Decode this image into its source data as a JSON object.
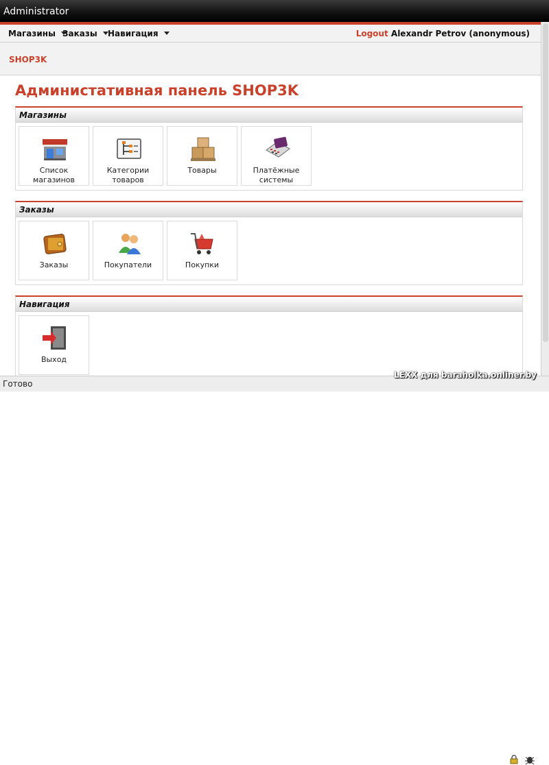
{
  "window": {
    "title": "Administrator"
  },
  "menu": {
    "items": [
      {
        "label": "Магазины"
      },
      {
        "label": "Заказы"
      },
      {
        "label": "Навигация"
      }
    ],
    "logout_label": "Logout",
    "user_label": "Alexandr Petrov (anonymous)"
  },
  "brand": {
    "label": "SHOP3K"
  },
  "page": {
    "title": "Администативная панель SHOP3K"
  },
  "sections": [
    {
      "title": "Магазины",
      "tiles": [
        {
          "label": "Список магазинов",
          "icon": "store-icon"
        },
        {
          "label": "Категории товаров",
          "icon": "category-tree-icon"
        },
        {
          "label": "Товары",
          "icon": "boxes-icon"
        },
        {
          "label": "Платёжные системы",
          "icon": "payment-terminal-icon"
        }
      ]
    },
    {
      "title": "Заказы",
      "tiles": [
        {
          "label": "Заказы",
          "icon": "wallet-icon"
        },
        {
          "label": "Покупатели",
          "icon": "customers-icon"
        },
        {
          "label": "Покупки",
          "icon": "shopping-cart-icon"
        }
      ]
    },
    {
      "title": "Навигация",
      "tiles": [
        {
          "label": "Выход",
          "icon": "exit-door-icon"
        }
      ]
    }
  ],
  "status": {
    "text": "Готово"
  },
  "watermark": {
    "text": "LEXX для baraholka.onliner.by"
  },
  "colors": {
    "accent": "#c9412b",
    "header_bg": "#000000",
    "panel_bg": "#f2f2f2"
  }
}
